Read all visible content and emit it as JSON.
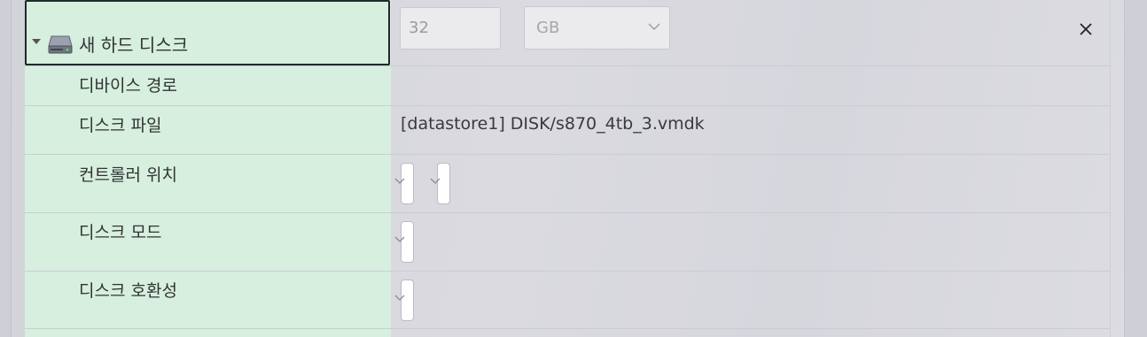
{
  "header": {
    "title": "새 하드 디스크",
    "size_value": "32",
    "size_unit": "GB",
    "icons": {
      "expand": "caret-down-icon",
      "disk": "hard-disk-icon",
      "close": "close-icon",
      "unit_chevron": "chevron-down-icon"
    }
  },
  "rows": [
    {
      "label": "디바이스 경로",
      "value": ""
    },
    {
      "label": "디스크 파일",
      "value": "[datastore1] DISK/s870_4tb_3.vmdk"
    },
    {
      "label": "컨트롤러 위치",
      "value": ""
    },
    {
      "label": "디스크 모드",
      "value": ""
    },
    {
      "label": "디스크 호환성",
      "value": ""
    }
  ],
  "colors": {
    "label_background": "#d6efdf",
    "panel_background": "#d9d9df",
    "header_border": "#1f2a2a"
  }
}
